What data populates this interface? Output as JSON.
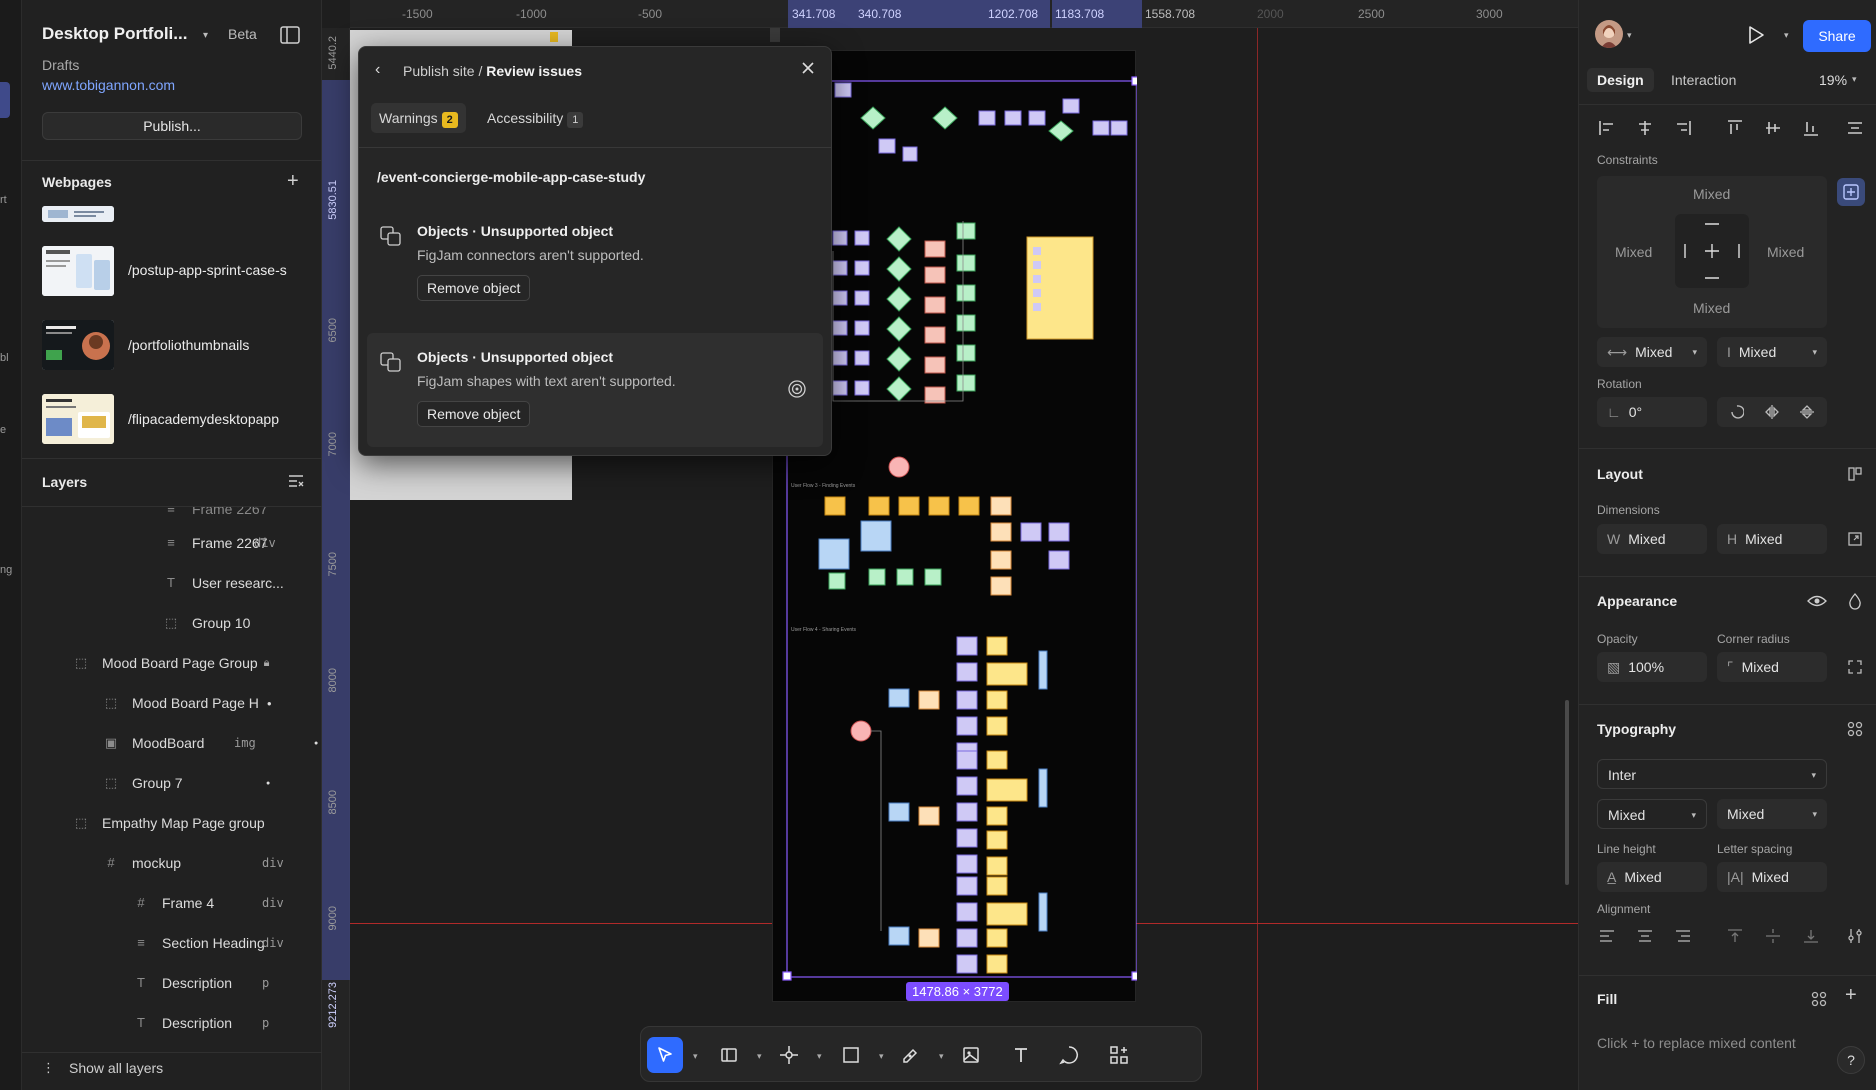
{
  "project": {
    "title": "Desktop Portfoli...",
    "badge": "Beta",
    "folder": "Drafts",
    "url": "www.tobigannon.com",
    "publish_label": "Publish..."
  },
  "webpages": {
    "heading": "Webpages",
    "items": [
      {
        "label": "/postup-app-sprint-case-s"
      },
      {
        "label": "/portfoliothumbnails"
      },
      {
        "label": "/flipacademydesktopapp"
      }
    ]
  },
  "layers": {
    "heading": "Layers",
    "show_all": "Show all layers",
    "items": [
      {
        "label": "Frame 2267",
        "tag": "div",
        "icon": "text-frame-icon"
      },
      {
        "label": "User researc...",
        "tag": "",
        "icon": "text-icon"
      },
      {
        "label": "Group 10",
        "tag": "",
        "icon": "group-icon"
      },
      {
        "label": "Mood Board Page Group",
        "tag": "",
        "icon": "group-icon"
      },
      {
        "label": "Mood Board Page H",
        "tag": "",
        "icon": "group-icon"
      },
      {
        "label": "MoodBoard",
        "tag": "img",
        "icon": "image-icon"
      },
      {
        "label": "Group 7",
        "tag": "",
        "icon": "group-icon"
      },
      {
        "label": "Empathy Map Page group",
        "tag": "",
        "icon": "group-icon"
      },
      {
        "label": "mockup",
        "tag": "div",
        "icon": "frame-icon"
      },
      {
        "label": "Frame 4",
        "tag": "div",
        "icon": "frame-icon"
      },
      {
        "label": "Section Heading",
        "tag": "div",
        "icon": "text-frame-icon"
      },
      {
        "label": "Description",
        "tag": "p",
        "icon": "text-icon"
      },
      {
        "label": "Description",
        "tag": "p",
        "icon": "text-icon"
      }
    ]
  },
  "edge_fragments": [
    "rt",
    "bl",
    "e",
    "ng"
  ],
  "ruler": {
    "top_ticks": [
      "-1500",
      "-1000",
      "-500",
      "341.708",
      "340.708",
      "1202.708",
      "1183.708",
      "1558.708",
      "2000",
      "2500",
      "3000"
    ],
    "left_ticks": [
      "5440.2",
      "5830.51",
      "6500",
      "7000",
      "7500",
      "8000",
      "8500",
      "9000",
      "9212.273"
    ]
  },
  "dialog": {
    "breadcrumb_parent": "Publish site /",
    "breadcrumb_current": "Review issues",
    "tabs": [
      {
        "label": "Warnings",
        "count": "2"
      },
      {
        "label": "Accessibility",
        "count": "1"
      }
    ],
    "path": "/event-concierge-mobile-app-case-study",
    "issues": [
      {
        "title": "Objects · Unsupported object",
        "desc": "FigJam connectors aren't supported.",
        "action": "Remove object"
      },
      {
        "title": "Objects · Unsupported object",
        "desc": "FigJam shapes with text aren't supported.",
        "action": "Remove object"
      }
    ]
  },
  "canvas": {
    "selection_size": "1478.86 × 3772",
    "board_labels": [
      "User Flow 3 - Finding Events",
      "User Flow 4 - Sharing Events"
    ]
  },
  "toolbar": {
    "tools": [
      "move-icon",
      "frame-icon",
      "pen-icon",
      "rectangle-icon",
      "pencil-icon",
      "image-icon",
      "text-icon",
      "comment-icon",
      "widgets-icon"
    ]
  },
  "right": {
    "share_label": "Share",
    "tabs": [
      "Design",
      "Interaction"
    ],
    "zoom": "19%",
    "constraints": {
      "heading": "Constraints",
      "top": "Mixed",
      "left": "Mixed",
      "right": "Mixed",
      "bottom": "Mixed",
      "horizontal": "Mixed",
      "vertical": "Mixed"
    },
    "rotation": {
      "heading": "Rotation",
      "value": "0°"
    },
    "layout": {
      "heading": "Layout",
      "dims_label": "Dimensions",
      "w_label": "W",
      "w": "Mixed",
      "h_label": "H",
      "h": "Mixed"
    },
    "appearance": {
      "heading": "Appearance",
      "opacity_label": "Opacity",
      "opacity": "100%",
      "radius_label": "Corner radius",
      "radius": "Mixed"
    },
    "typography": {
      "heading": "Typography",
      "font": "Inter",
      "weight": "Mixed",
      "size": "Mixed",
      "line_height_label": "Line height",
      "line_height": "Mixed",
      "letter_spacing_label": "Letter spacing",
      "letter_spacing": "Mixed",
      "alignment_label": "Alignment"
    },
    "fill": {
      "heading": "Fill",
      "hint": "Click + to replace mixed content"
    },
    "help": "?"
  },
  "colors": {
    "accent": "#2f6bff",
    "selection": "#7c4dff",
    "warning": "#e8b91f"
  }
}
